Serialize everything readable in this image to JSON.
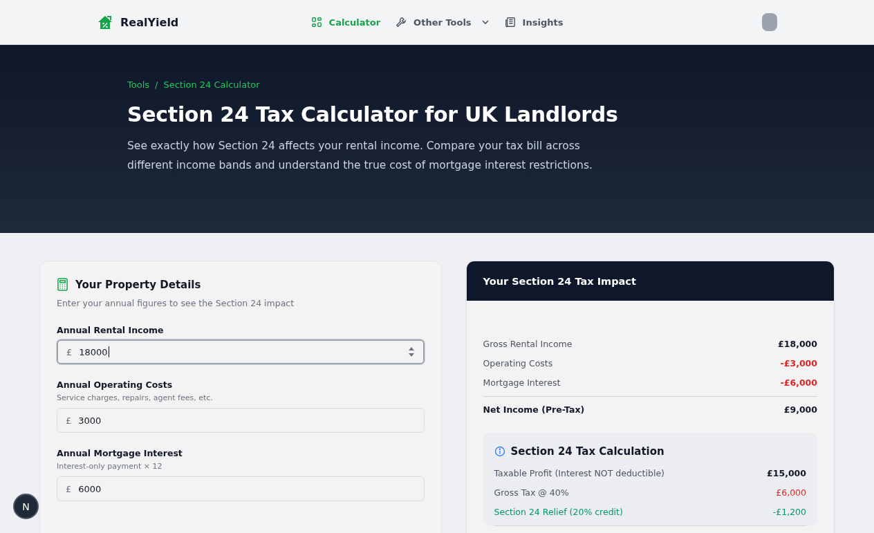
{
  "nav": {
    "brand": "RealYield",
    "links": [
      {
        "label": "Calculator",
        "selected": true,
        "dropdown": false
      },
      {
        "label": "Other Tools",
        "selected": false,
        "dropdown": true
      },
      {
        "label": "Insights",
        "selected": false,
        "dropdown": false
      }
    ]
  },
  "hero": {
    "breadcrumb": [
      "Tools",
      "Section 24 Calculator"
    ],
    "separator": "/",
    "title": "Section 24 Tax Calculator for UK Landlords",
    "subtitle": "See exactly how Section 24 affects your rental income. Compare your tax bill across different income bands and understand the true cost of mortgage interest restrictions."
  },
  "form": {
    "title": "Your Property Details",
    "subtitle": "Enter your annual figures to see the Section 24 impact",
    "fields": [
      {
        "label": "Annual Rental Income",
        "prefix": "£",
        "value": "18000",
        "focused": true
      },
      {
        "label": "Annual Operating Costs",
        "hint": "Service charges, repairs, agent fees, etc.",
        "prefix": "£",
        "value": "3000",
        "focused": false
      },
      {
        "label": "Annual Mortgage Interest",
        "hint": "Interest-only payment × 12",
        "prefix": "£",
        "value": "6000",
        "focused": false
      }
    ]
  },
  "results": {
    "title": "Your Section 24 Tax Impact",
    "rows": [
      {
        "label": "Gross Rental Income",
        "value": "£18,000",
        "kind": "income"
      },
      {
        "label": "Operating Costs",
        "value": "-£3,000",
        "kind": "cost"
      },
      {
        "label": "Mortgage Interest",
        "value": "-£6,000",
        "kind": "cost"
      },
      {
        "label": "Net Income (Pre-Tax)",
        "value": "£9,000",
        "kind": "total"
      }
    ],
    "calculation": {
      "title": "Section 24 Tax Calculation",
      "rows": [
        {
          "label": "Taxable Profit (Interest NOT deductible)",
          "value": "£15,000",
          "kind": "profit"
        },
        {
          "label": "Gross Tax @ 40%",
          "value": "£6,000",
          "kind": "tax"
        },
        {
          "label": "Section 24 Relief (20% credit)",
          "value": "-£1,200",
          "kind": "relief"
        }
      ]
    }
  },
  "dev_badge": "N"
}
